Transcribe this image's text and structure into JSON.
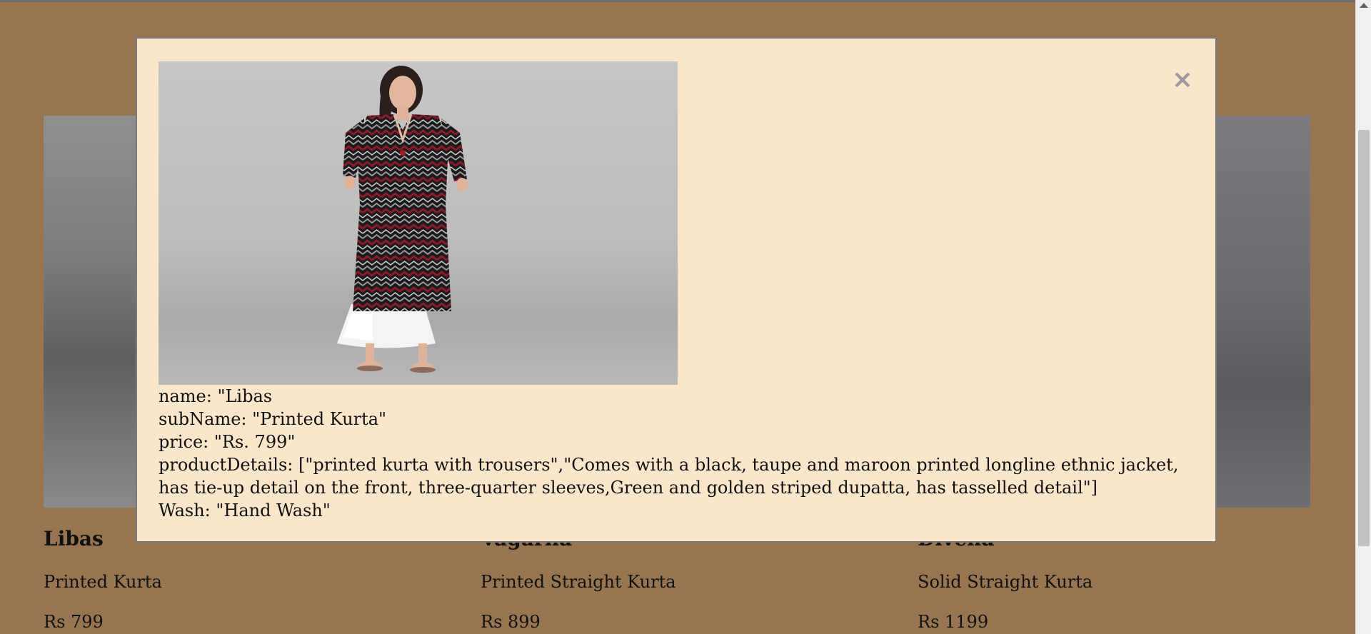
{
  "products": [
    {
      "name": "Libas",
      "sub": "Printed Kurta",
      "price": "Rs 799"
    },
    {
      "name": "Vagarna",
      "sub": "Printed Straight Kurta",
      "price": "Rs 899"
    },
    {
      "name": "Divena",
      "sub": "Solid Straight Kurta",
      "price": "Rs 1199"
    }
  ],
  "modal": {
    "close_label": "×",
    "details": {
      "name": "name: \"Libas",
      "subName": "subName: \"Printed Kurta\"",
      "price": "price: \"Rs. 799\"",
      "productDetails": "productDetails: [\"printed kurta with trousers\",\"Comes with a black, taupe and maroon printed longline ethnic jacket, has tie-up detail on the front, three-quarter sleeves,Green and golden striped dupatta, has tasselled detail\"]",
      "wash": "Wash: \"Hand Wash\""
    }
  },
  "colors": {
    "page_background": "#977550",
    "modal_background": "#fae6cb",
    "kurta_black": "#1d1a1d",
    "kurta_maroon": "#8a1b2a",
    "trousers_white": "#f4f4f2"
  },
  "icons": {
    "close": "close-icon",
    "scroll_up": "chevron-up-icon"
  }
}
